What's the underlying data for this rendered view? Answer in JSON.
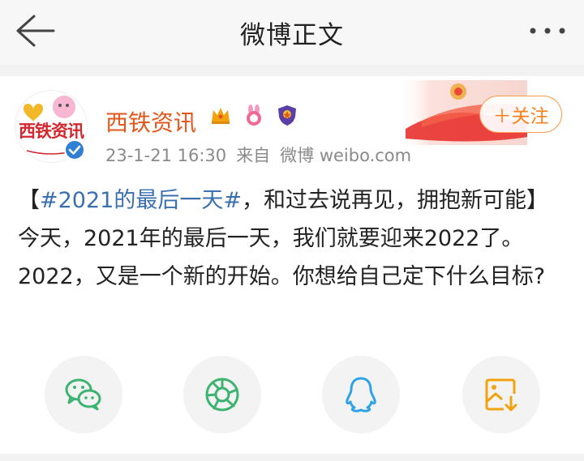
{
  "header": {
    "title": "微博正文",
    "back_icon": "back-arrow-icon",
    "more_icon": "more-dots-icon"
  },
  "post": {
    "author": {
      "name": "西铁资讯",
      "avatar_text": "西铁资讯",
      "verified": true
    },
    "time": "23-1-21 16:30",
    "source_prefix": "来自",
    "source": "微博 weibo.com",
    "follow_label": "＋关注",
    "content_open": "【",
    "topic": "#2021的最后一天#",
    "content_rest": "，和过去说再见，拥抱新可能】今天，2021年的最后一天，我们就要迎来2022了。2022，又是一个新的开始。你想给自己定下什么目标?"
  },
  "share": [
    {
      "name": "wechat-share-button",
      "icon": "wechat-icon",
      "color": "#3cb371"
    },
    {
      "name": "moments-share-button",
      "icon": "moments-icon",
      "color": "#3cb371"
    },
    {
      "name": "qq-share-button",
      "icon": "qq-icon",
      "color": "#2fa3e6"
    },
    {
      "name": "save-image-button",
      "icon": "save-image-icon",
      "color": "#f2a10f"
    }
  ],
  "colors": {
    "username": "#e2571b",
    "topic": "#3a6fb0",
    "follow": "#ff7f1a",
    "verified": "#2f7fd3"
  }
}
